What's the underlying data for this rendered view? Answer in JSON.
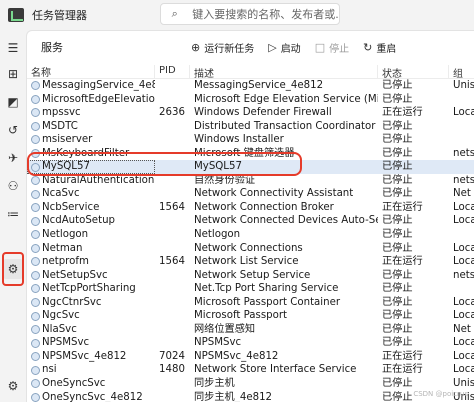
{
  "titlebar": {
    "title": "任务管理器",
    "search_placeholder": "键入要搜索的名称、发布者或..."
  },
  "rail": {
    "items": [
      {
        "name": "hamburger-icon",
        "glyph": "☰"
      },
      {
        "name": "processes-icon",
        "glyph": "⊞"
      },
      {
        "name": "performance-icon",
        "glyph": "◩"
      },
      {
        "name": "app-history-icon",
        "glyph": "↺"
      },
      {
        "name": "startup-apps-icon",
        "glyph": "✈"
      },
      {
        "name": "users-icon",
        "glyph": "⚇"
      },
      {
        "name": "details-icon",
        "glyph": "≔"
      },
      {
        "name": "services-icon",
        "glyph": "⚙"
      },
      {
        "name": "settings-icon",
        "glyph": "⚙"
      }
    ]
  },
  "toolbar": {
    "section_title": "服务",
    "run_new_task": "运行新任务",
    "start": "启动",
    "stop": "停止",
    "restart": "重启"
  },
  "table": {
    "headers": {
      "name": "名称",
      "pid": "PID",
      "desc": "描述",
      "status": "状态",
      "group": "组"
    },
    "rows": [
      {
        "name": "MessagingService_4e81...",
        "pid": "",
        "desc": "MessagingService_4e812",
        "status": "已停止",
        "group": "Unis"
      },
      {
        "name": "MicrosoftEdgeElevatio...",
        "pid": "",
        "desc": "Microsoft Edge Elevation Service (Micr...",
        "status": "已停止",
        "group": ""
      },
      {
        "name": "mpssvc",
        "pid": "2636",
        "desc": "Windows Defender Firewall",
        "status": "正在运行",
        "group": "Loca"
      },
      {
        "name": "MSDTC",
        "pid": "",
        "desc": "Distributed Transaction Coordinator",
        "status": "已停止",
        "group": ""
      },
      {
        "name": "msiserver",
        "pid": "",
        "desc": "Windows Installer",
        "status": "已停止",
        "group": ""
      },
      {
        "name": "MsKeyboardFilter",
        "pid": "",
        "desc": "Microsoft 键盘筛选器",
        "status": "已停止",
        "group": "nets"
      },
      {
        "name": "MySQL57",
        "pid": "",
        "desc": "MySQL57",
        "status": "已停止",
        "group": ""
      },
      {
        "name": "NaturalAuthentication",
        "pid": "",
        "desc": "自然身份验证",
        "status": "已停止",
        "group": "nets"
      },
      {
        "name": "NcaSvc",
        "pid": "",
        "desc": "Network Connectivity Assistant",
        "status": "已停止",
        "group": "Net"
      },
      {
        "name": "NcbService",
        "pid": "1564",
        "desc": "Network Connection Broker",
        "status": "正在运行",
        "group": "Loca"
      },
      {
        "name": "NcdAutoSetup",
        "pid": "",
        "desc": "Network Connected Devices Auto-Setup",
        "status": "已停止",
        "group": "Loca"
      },
      {
        "name": "Netlogon",
        "pid": "",
        "desc": "Netlogon",
        "status": "已停止",
        "group": ""
      },
      {
        "name": "Netman",
        "pid": "",
        "desc": "Network Connections",
        "status": "已停止",
        "group": "Loca"
      },
      {
        "name": "netprofm",
        "pid": "1564",
        "desc": "Network List Service",
        "status": "正在运行",
        "group": "Loca"
      },
      {
        "name": "NetSetupSvc",
        "pid": "",
        "desc": "Network Setup Service",
        "status": "已停止",
        "group": "nets"
      },
      {
        "name": "NetTcpPortSharing",
        "pid": "",
        "desc": "Net.Tcp Port Sharing Service",
        "status": "已停止",
        "group": ""
      },
      {
        "name": "NgcCtnrSvc",
        "pid": "",
        "desc": "Microsoft Passport Container",
        "status": "已停止",
        "group": "Loca"
      },
      {
        "name": "NgcSvc",
        "pid": "",
        "desc": "Microsoft Passport",
        "status": "已停止",
        "group": "Loca"
      },
      {
        "name": "NlaSvc",
        "pid": "",
        "desc": "网络位置感知",
        "status": "已停止",
        "group": "Net"
      },
      {
        "name": "NPSMSvc",
        "pid": "",
        "desc": "NPSMSvc",
        "status": "已停止",
        "group": "Loca"
      },
      {
        "name": "NPSMSvc_4e812",
        "pid": "7024",
        "desc": "NPSMSvc_4e812",
        "status": "正在运行",
        "group": "Loca"
      },
      {
        "name": "nsi",
        "pid": "1480",
        "desc": "Network Store Interface Service",
        "status": "正在运行",
        "group": "Loca"
      },
      {
        "name": "OneSyncSvc",
        "pid": "",
        "desc": "同步主机",
        "status": "已停止",
        "group": "Unis"
      },
      {
        "name": "OneSyncSvc_4e812",
        "pid": "",
        "desc": "同步主机_4e812",
        "status": "已停止",
        "group": "Unis"
      }
    ],
    "selected_index": 6
  },
  "colors": {
    "highlight_red": "#e53b2a",
    "selection_blue": "#dfe9f6"
  },
  "watermark": "CSDN @poicrus"
}
